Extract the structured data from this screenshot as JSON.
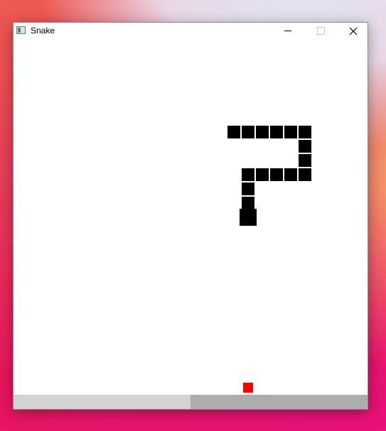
{
  "window": {
    "title": "Snake",
    "icon": "app-window-icon",
    "controls": [
      "minimize-icon",
      "maximize-icon",
      "close-icon"
    ]
  },
  "game": {
    "grid_cell": "20",
    "snake_cells": [
      [
        15,
        6
      ],
      [
        16,
        6
      ],
      [
        17,
        6
      ],
      [
        18,
        6
      ],
      [
        19,
        6
      ],
      [
        20,
        6
      ],
      [
        20,
        7
      ],
      [
        20,
        8
      ],
      [
        20,
        9
      ],
      [
        19,
        9
      ],
      [
        18,
        9
      ],
      [
        17,
        9
      ],
      [
        16,
        9
      ],
      [
        16,
        10
      ],
      [
        16,
        11
      ]
    ],
    "snake_head_cell": [
      16,
      12
    ],
    "food_cell": [
      16,
      24
    ],
    "snake_color": "#000000",
    "food_color": "#ff0000"
  },
  "status_bar": {
    "fill_fraction": 0.5,
    "track_color": "#d3d3d3",
    "fill_color": "#adadad"
  }
}
